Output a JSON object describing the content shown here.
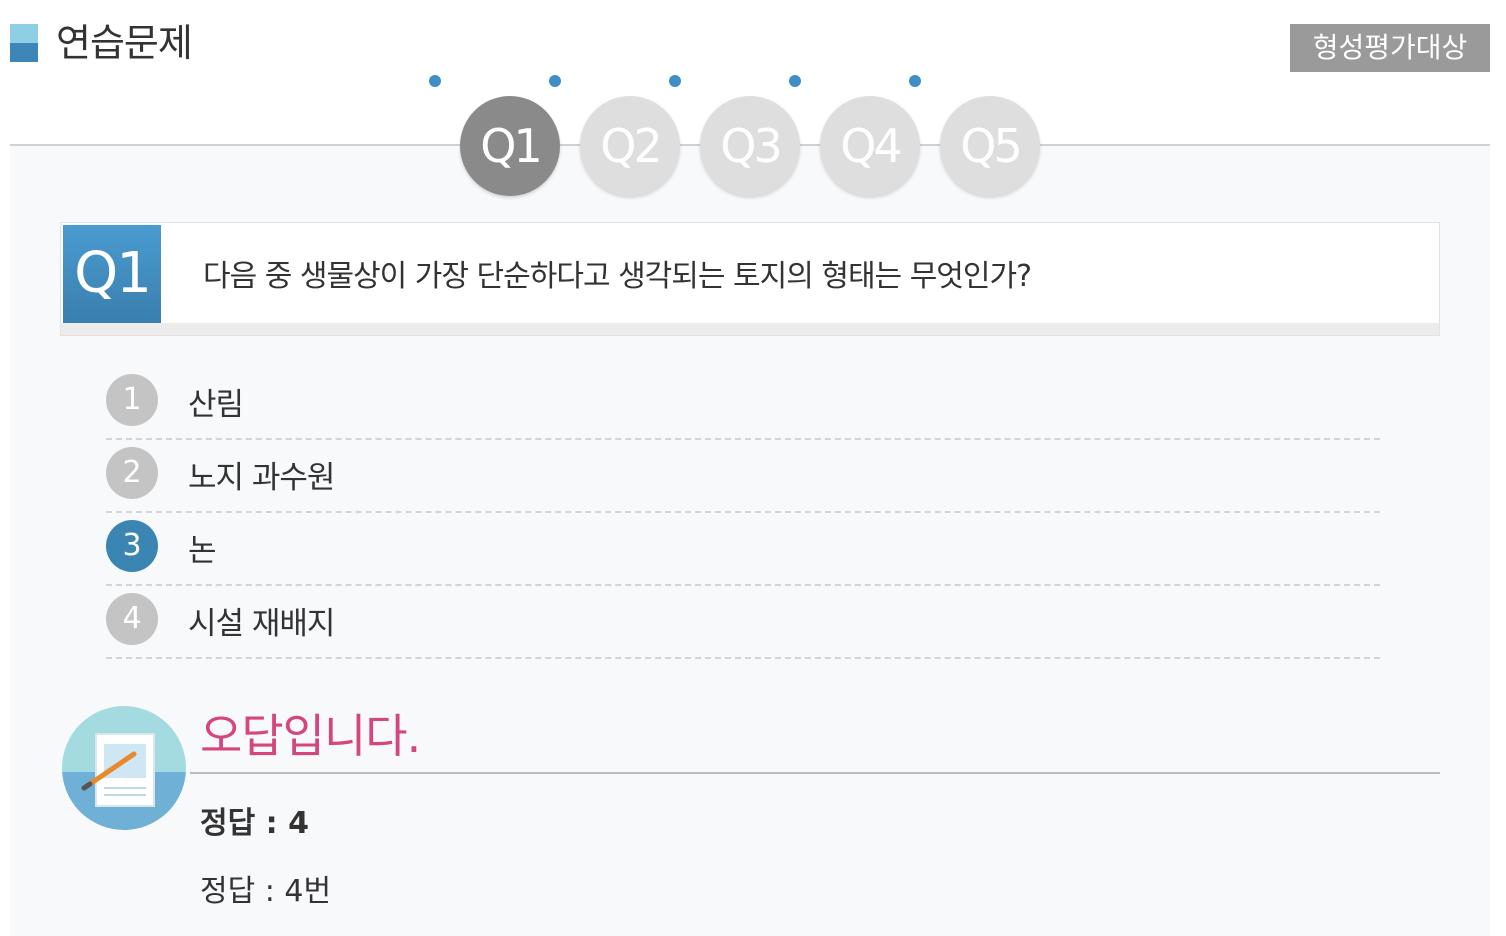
{
  "header": {
    "title": "연습문제",
    "badge": "형성평가대상"
  },
  "tabs": [
    {
      "label": "Q1",
      "active": true
    },
    {
      "label": "Q2",
      "active": false
    },
    {
      "label": "Q3",
      "active": false
    },
    {
      "label": "Q4",
      "active": false
    },
    {
      "label": "Q5",
      "active": false
    }
  ],
  "question": {
    "number": "Q1",
    "text": "다음 중 생물상이 가장 단순하다고 생각되는 토지의 형태는 무엇인가?"
  },
  "options": [
    {
      "num": "1",
      "text": "산림",
      "selected": false
    },
    {
      "num": "2",
      "text": "노지 과수원",
      "selected": false
    },
    {
      "num": "3",
      "text": "논",
      "selected": true
    },
    {
      "num": "4",
      "text": "시설 재배지",
      "selected": false
    }
  ],
  "result": {
    "title": "오답입니다.",
    "answer": "정답 : 4",
    "explanation": "정답 : 4번"
  },
  "colors": {
    "accent": "#3a85b2",
    "wrong": "#d3467e",
    "tab_active": "#8a8a8a",
    "tab_inactive": "#dedede"
  }
}
